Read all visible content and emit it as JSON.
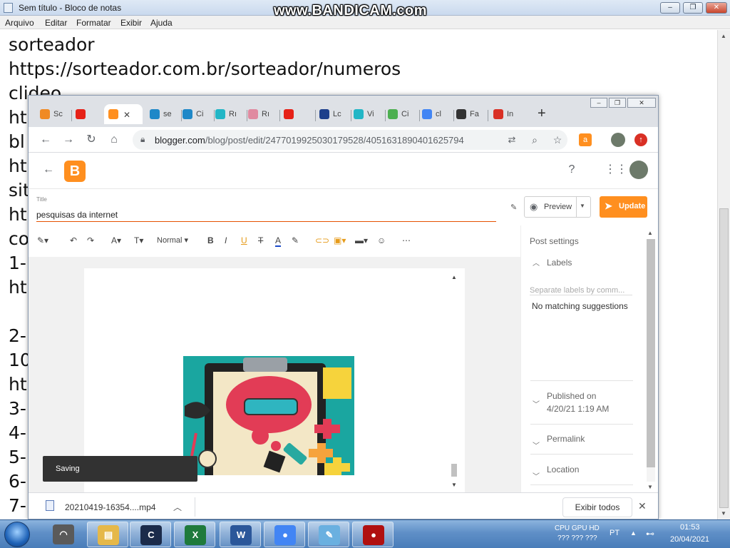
{
  "notepad": {
    "title": "Sem título - Bloco de notas",
    "menu": [
      "Arquivo",
      "Editar",
      "Formatar",
      "Exibir",
      "Ajuda"
    ],
    "lines": [
      "sorteador",
      "https://sorteador.com.br/sorteador/numeros",
      "clideo",
      "ht",
      "bl",
      "ht",
      "sit",
      "ht",
      "co",
      "1-",
      "ht",
      "",
      "2-",
      "10",
      "ht",
      "3-",
      "4-",
      "5-",
      "6-",
      "7-"
    ],
    "controls": {
      "minimize": "‒",
      "restore": "❐",
      "close": "✕"
    }
  },
  "watermark": "www.BANDICAM.com",
  "chrome": {
    "tabs": [
      {
        "label": "Sc",
        "icon": "sorteador-icon",
        "color": "#f08a24"
      },
      {
        "label": "",
        "icon": "youtube-icon",
        "color": "#e62117"
      },
      {
        "label": "",
        "icon": "blogger-icon",
        "color": "#ff8f1f",
        "active": true
      },
      {
        "label": "se",
        "icon": "dna-icon",
        "color": "#1e88c8"
      },
      {
        "label": "Ci",
        "icon": "dna-icon",
        "color": "#1e88c8"
      },
      {
        "label": "Rı",
        "icon": "play-icon",
        "color": "#22b6c6"
      },
      {
        "label": "Rı",
        "icon": "link-icon",
        "color": "#e08aa0"
      },
      {
        "label": "",
        "icon": "youtube-icon",
        "color": "#e62117"
      },
      {
        "label": "Lc",
        "icon": "lorem-icon",
        "color": "#1c3f8c"
      },
      {
        "label": "Vi",
        "icon": "play-icon",
        "color": "#22b6c6"
      },
      {
        "label": "Ci",
        "icon": "pinwheel-icon",
        "color": "#4caf50"
      },
      {
        "label": "cl",
        "icon": "google-icon",
        "color": "#4285f4"
      },
      {
        "label": "Fa",
        "icon": "heart-icon",
        "color": "#333333"
      },
      {
        "label": "In",
        "icon": "gmail-icon",
        "color": "#d93025"
      }
    ],
    "new_tab": "+",
    "url_host": "blogger.com",
    "url_path": "/blog/post/edit/2477019925030179528/4051631890401625794",
    "window_controls": {
      "minimize": "‒",
      "restore": "❐",
      "close": "✕"
    }
  },
  "blogger": {
    "title_label": "Title",
    "post_title": "pesquisas da internet",
    "preview_label": "Preview",
    "update_label": "Update",
    "format_style": "Normal",
    "toast": "Saving",
    "post_settings": {
      "heading": "Post settings",
      "labels_heading": "Labels",
      "labels_placeholder": "Separate labels by comm...",
      "no_match": "No matching suggestions",
      "published_label": "Published on",
      "published_date": "4/20/21 1:19 AM",
      "permalink": "Permalink",
      "location": "Location"
    }
  },
  "download": {
    "file": "20210419-16354....mp4",
    "show_all": "Exibir todos"
  },
  "taskbar": {
    "apps": [
      {
        "name": "vpn-app",
        "color": "#5a5a5a",
        "glyph": "◠"
      },
      {
        "name": "explorer",
        "color": "#e5b84a",
        "glyph": "▤"
      },
      {
        "name": "ccleaner",
        "color": "#1b2b4a",
        "glyph": "C"
      },
      {
        "name": "excel",
        "color": "#1f7a3c",
        "glyph": "X"
      },
      {
        "name": "word",
        "color": "#2b579a",
        "glyph": "W"
      },
      {
        "name": "chrome",
        "color": "#4285f4",
        "glyph": "●"
      },
      {
        "name": "notepad",
        "color": "#6ab0e0",
        "glyph": "✎"
      },
      {
        "name": "bandicam",
        "color": "#b01010",
        "glyph": "●"
      }
    ],
    "cpu_label": "CPU GPU HD",
    "cpu_values": "???  ???  ???",
    "lang": "PT",
    "time": "01:53",
    "date": "20/04/2021"
  }
}
